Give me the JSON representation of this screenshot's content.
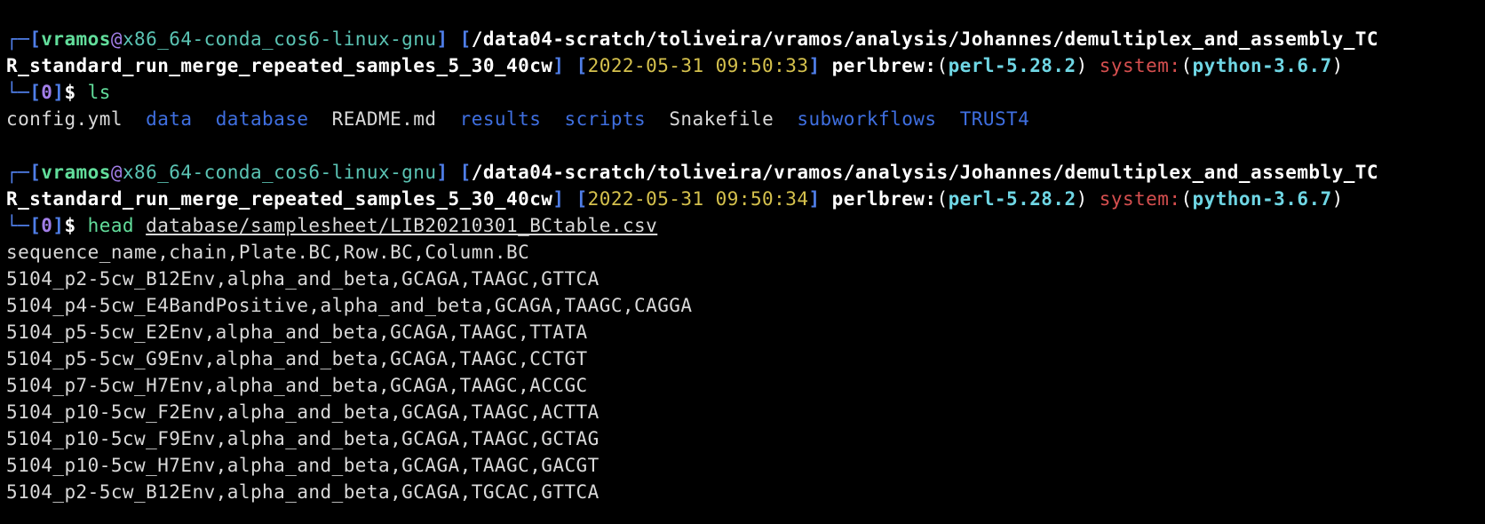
{
  "prompts": [
    {
      "box_top": "┌─",
      "box_bottom": "└─",
      "user": "vramos",
      "at": "@",
      "host": "x86_64-conda_cos6-linux-gnu",
      "path_part1": "/data04-scratch/toliveira/vramos/analysis/Johannes/demultiplex_and_assembly_TC",
      "path_part2": "R_standard_run_merge_repeated_samples_5_30_40cw",
      "datetime": "2022-05-31 09:50:33",
      "perlbrew_label": "perlbrew:",
      "perl_version": "perl-5.28.2",
      "system_label": "system:",
      "python_version": "python-3.6.7",
      "exit_code": "0",
      "dollar": "$",
      "command": "ls",
      "argument": ""
    },
    {
      "box_top": "┌─",
      "box_bottom": "└─",
      "user": "vramos",
      "at": "@",
      "host": "x86_64-conda_cos6-linux-gnu",
      "path_part1": "/data04-scratch/toliveira/vramos/analysis/Johannes/demultiplex_and_assembly_TC",
      "path_part2": "R_standard_run_merge_repeated_samples_5_30_40cw",
      "datetime": "2022-05-31 09:50:34",
      "perlbrew_label": "perlbrew:",
      "perl_version": "perl-5.28.2",
      "system_label": "system:",
      "python_version": "python-3.6.7",
      "exit_code": "0",
      "dollar": "$",
      "command": "head",
      "argument": "database/samplesheet/LIB20210301_BCtable.csv"
    }
  ],
  "ls_output": [
    {
      "name": "config.yml",
      "type": "file"
    },
    {
      "name": "data",
      "type": "directory"
    },
    {
      "name": "database",
      "type": "directory"
    },
    {
      "name": "README.md",
      "type": "file"
    },
    {
      "name": "results",
      "type": "directory"
    },
    {
      "name": "scripts",
      "type": "directory"
    },
    {
      "name": "Snakefile",
      "type": "file"
    },
    {
      "name": "subworkflows",
      "type": "directory"
    },
    {
      "name": "TRUST4",
      "type": "directory"
    }
  ],
  "head_output": [
    "sequence_name,chain,Plate.BC,Row.BC,Column.BC",
    "5104_p2-5cw_B12Env,alpha_and_beta,GCAGA,TAAGC,GTTCA",
    "5104_p4-5cw_E4BandPositive,alpha_and_beta,GCAGA,TAAGC,CAGGA",
    "5104_p5-5cw_E2Env,alpha_and_beta,GCAGA,TAAGC,TTATA",
    "5104_p5-5cw_G9Env,alpha_and_beta,GCAGA,TAAGC,CCTGT",
    "5104_p7-5cw_H7Env,alpha_and_beta,GCAGA,TAAGC,ACCGC",
    "5104_p10-5cw_F2Env,alpha_and_beta,GCAGA,TAAGC,ACTTA",
    "5104_p10-5cw_F9Env,alpha_and_beta,GCAGA,TAAGC,GCTAG",
    "5104_p10-5cw_H7Env,alpha_and_beta,GCAGA,TAAGC,GACGT",
    "5104_p2-5cw_B12Env,alpha_and_beta,GCAGA,TGCAC,GTTCA"
  ],
  "colors": {
    "background": "#000000",
    "bracket": "#4f7ee8",
    "user": "#62dd9b",
    "host": "#5bc4b4",
    "date": "#d5c14d",
    "perl": "#6fd6e4",
    "system": "#d64f4f",
    "directory": "#3f6fe0",
    "text": "#d9d9d9"
  }
}
